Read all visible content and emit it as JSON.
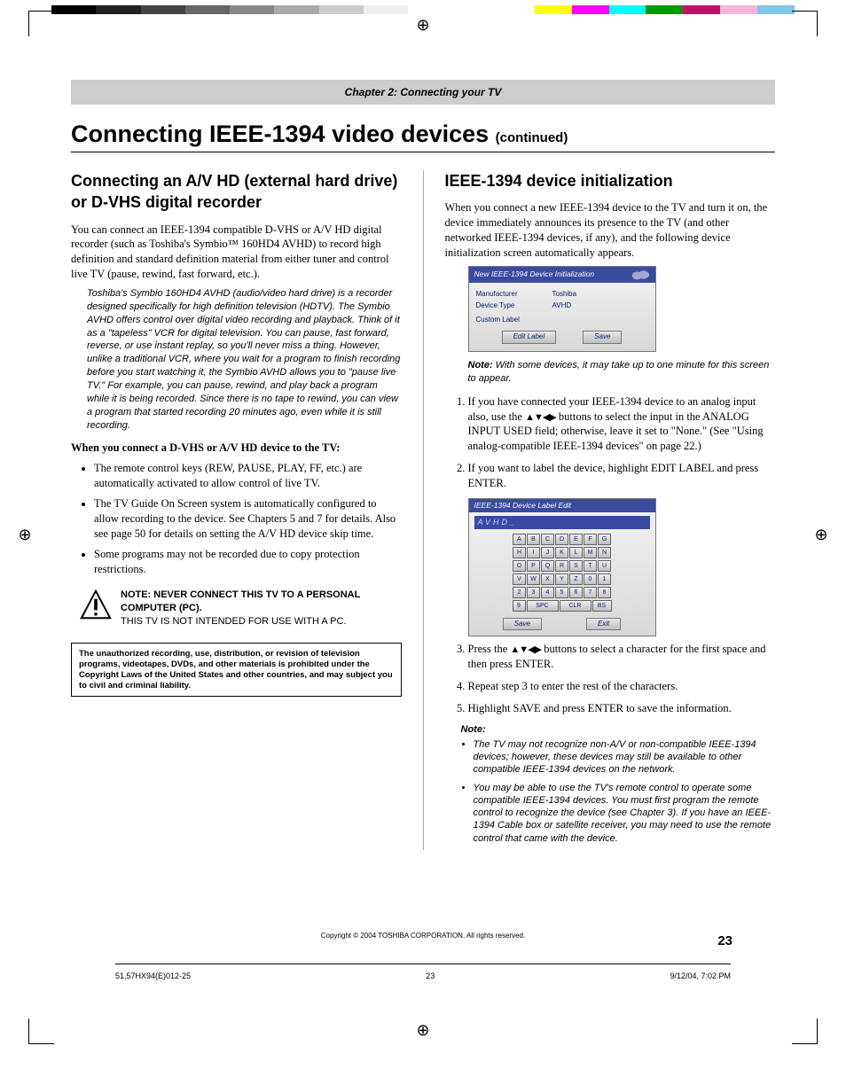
{
  "chapter_header": "Chapter 2: Connecting your TV",
  "title_main": "Connecting IEEE-1394 video devices ",
  "title_cont": "(continued)",
  "left": {
    "h2": "Connecting an A/V HD (external hard drive) or D-VHS digital recorder",
    "p1": "You can connect an IEEE-1394 compatible D-VHS or A/V HD digital recorder (such as Toshiba's Symbio™ 160HD4 AVHD) to record high definition and standard definition material from either tuner and control live TV (pause, rewind, fast forward, etc.).",
    "italic": "Toshiba's Symbio 160HD4 AVHD (audio/video hard drive) is a recorder designed specifically for high definition television (HDTV). The Symbio AVHD offers control over digital video recording and playback. Think of it as a \"tapeless\" VCR for digital television. You can pause, fast forward, reverse, or use instant replay, so you'll never miss a thing. However, unlike a traditional VCR, where you wait for a program to finish recording before you start watching it, the Symbio AVHD allows you to \"pause live TV.\"  For example, you can pause, rewind, and play back a program while it is being recorded. Since there is no tape to rewind, you can view a program that started recording 20 minutes ago, even while it is still recording.",
    "bold": "When you connect a D-VHS or A/V HD device to the TV:",
    "bul1": "The remote control keys (REW, PAUSE, PLAY, FF, etc.) are automatically activated to allow control of live TV.",
    "bul2": "The TV Guide On Screen system is automatically configured to allow recording to the device. See Chapters 5 and 7 for details. Also see page 50 for details on setting the A/V HD device skip time.",
    "bul3": "Some programs may not be recorded due to copy protection restrictions.",
    "warn_hdr": "NOTE: NEVER CONNECT THIS TV TO A PERSONAL COMPUTER (PC).",
    "warn_sub": "THIS TV IS NOT INTENDED FOR USE WITH A PC.",
    "legal": "The unauthorized recording, use, distribution, or revision of television programs, videotapes, DVDs, and other materials is prohibited under the Copyright Laws of the United States and other countries, and may subject you to civil and criminal liability."
  },
  "right": {
    "h2": "IEEE-1394 device initialization",
    "p1": "When you connect a new IEEE-1394 device to the TV and turn it on, the device immediately announces its presence to the TV (and other networked IEEE-1394 devices, if any), and the following device initialization screen automatically appears.",
    "fig1": {
      "title": "New IEEE-1394 Device Initialization",
      "mfr_lab": "Manufacturer",
      "mfr_val": "Toshiba",
      "type_lab": "Device Type",
      "type_val": "AVHD",
      "custom": "Custom Label",
      "btn_edit": "Edit Label",
      "btn_save": "Save"
    },
    "note1_b": "Note:",
    "note1": " With some devices, it may take up to one minute for this screen to appear.",
    "step1a": "If you have connected your IEEE-1394 device to an analog input also, use the ",
    "arrows": "▲▼◀▶",
    "step1b": " buttons to select the input in the ANALOG INPUT USED field; otherwise, leave it set to \"None.\" (See \"Using analog-compatible IEEE-1394 devices\" on page 22.)",
    "step2": "If you want to label the device, highlight EDIT LABEL and press ENTER.",
    "fig2": {
      "title": "IEEE-1394 Device Label Edit",
      "value": "AVHD_",
      "keys_row1": [
        "A",
        "B",
        "C",
        "D",
        "E",
        "F",
        "G"
      ],
      "keys_row2": [
        "H",
        "I",
        "J",
        "K",
        "L",
        "M",
        "N"
      ],
      "keys_row3": [
        "O",
        "P",
        "Q",
        "R",
        "S",
        "T",
        "U"
      ],
      "keys_row4": [
        "V",
        "W",
        "X",
        "Y",
        "Z",
        "0",
        "1"
      ],
      "keys_row5": [
        "2",
        "3",
        "4",
        "5",
        "6",
        "7",
        "8"
      ],
      "keys_row6": [
        "9",
        "SPC",
        "CLR",
        "BS"
      ],
      "btn_save": "Save",
      "btn_exit": "Exit"
    },
    "step3a": "Press the ",
    "step3b": " buttons to select a character for the first space and then press ENTER.",
    "step4": "Repeat step 3 to enter the rest of the characters.",
    "step5": "Highlight SAVE and press ENTER to save the information.",
    "note2_hd": "Note:",
    "note2_b1": "The TV may not recognize non-A/V or non-compatible IEEE-1394 devices; however, these devices may still be available to other compatible IEEE-1394 devices on the network.",
    "note2_b2": "You may be able to use the TV's remote control to operate some compatible IEEE-1394 devices. You must first program the remote control to recognize the device (see Chapter 3). If you have an IEEE-1394 Cable box or satellite receiver, you may need to use the remote control that came with the device."
  },
  "copyright": "Copyright © 2004 TOSHIBA CORPORATION. All rights reserved.",
  "pagenum": "23",
  "foot_file": "51,57HX94(E)012-25",
  "foot_pg": "23",
  "foot_date": "9/12/04, 7:02 PM"
}
